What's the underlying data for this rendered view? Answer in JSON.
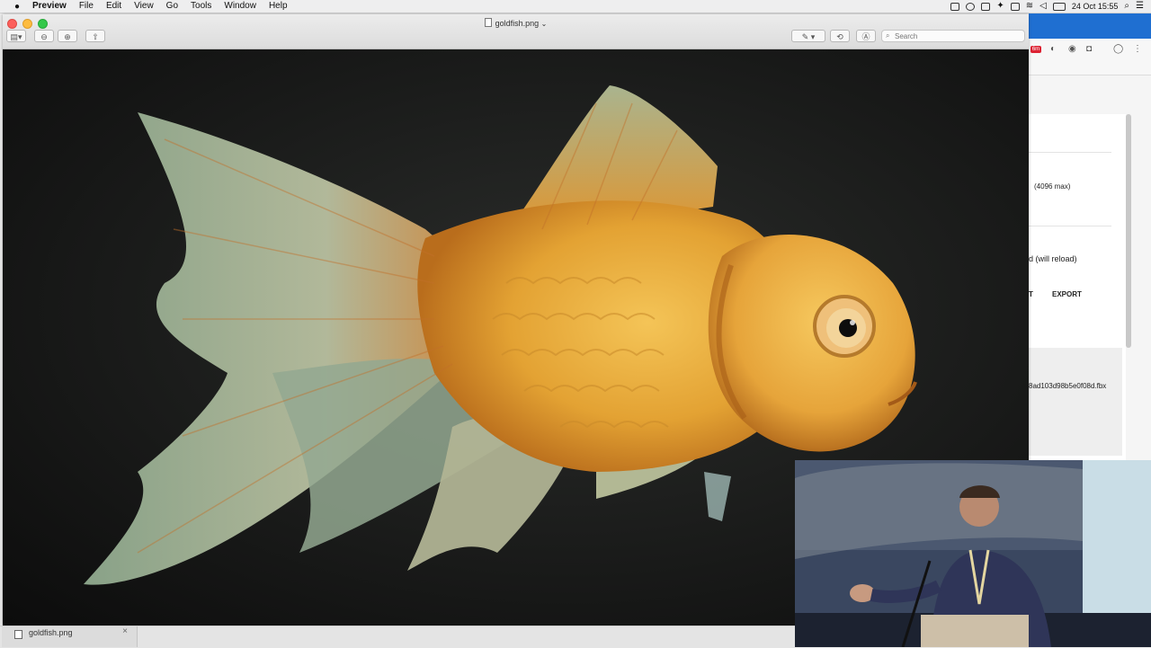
{
  "menubar": {
    "items": [
      "Preview",
      "File",
      "Edit",
      "View",
      "Go",
      "Tools",
      "Window",
      "Help"
    ],
    "clock": "24 Oct  15:55"
  },
  "window": {
    "title": "goldfish.png",
    "title_chevron": "⌄",
    "search_placeholder": "Search"
  },
  "tabs": [
    {
      "label": "goldfish.png"
    }
  ],
  "background_app": {
    "max_text": "(4096 max)",
    "reload_text": "d (will reload)",
    "t_text": "T",
    "export_label": "EXPORT",
    "file_text": "8ad103d98b5e0f08d.fbx",
    "badge": "6m"
  },
  "colors": {
    "accent_blue": "#1f6fd1",
    "fish_gold": "#e8a530",
    "fin_teal": "#9fb39a"
  }
}
